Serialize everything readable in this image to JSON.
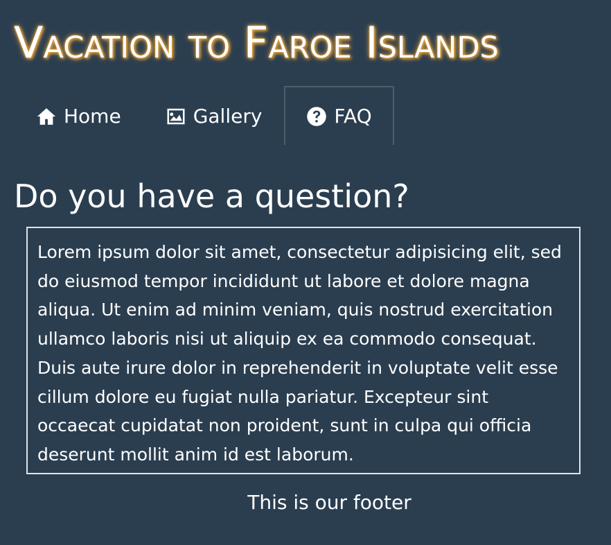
{
  "header": {
    "title": "Vacation to Faroe Islands"
  },
  "nav": {
    "tabs": [
      {
        "label": "Home",
        "icon": "home-icon",
        "active": false
      },
      {
        "label": "Gallery",
        "icon": "image-icon",
        "active": false
      },
      {
        "label": "FAQ",
        "icon": "question-circle-icon",
        "active": true
      }
    ]
  },
  "main": {
    "heading": "Do you have a question?",
    "body": "Lorem ipsum dolor sit amet, consectetur adipisicing elit, sed do eiusmod tempor incididunt ut labore et dolore magna aliqua. Ut enim ad minim veniam, quis nostrud exercitation ullamco laboris nisi ut aliquip ex ea commodo consequat. Duis aute irure dolor in reprehenderit in voluptate velit esse cillum dolore eu fugiat nulla pariatur. Excepteur sint occaecat cupidatat non proident, sunt in culpa qui officia deserunt mollit anim id est laborum."
  },
  "footer": {
    "text": "This is our footer"
  },
  "colors": {
    "background": "#2b3e50",
    "text": "#ffffff",
    "title_glow": "#e8a33a",
    "active_tab_border": "#4e5d6c",
    "box_border": "#dfe4e8"
  }
}
